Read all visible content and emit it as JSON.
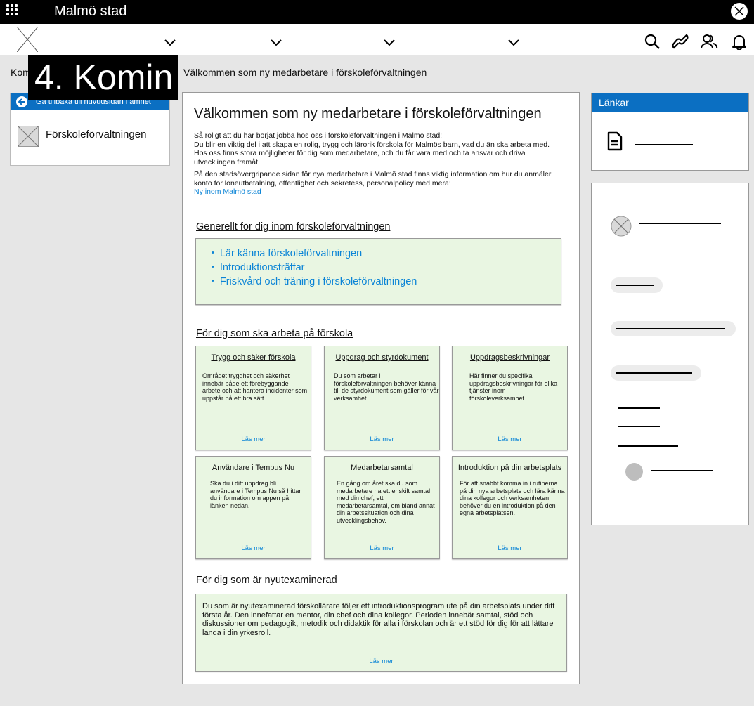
{
  "topbar": {
    "brand": "Malmö stad",
    "apps_icon": "apps-grid-icon",
    "close_icon": "close-circle-icon"
  },
  "nav": {
    "dropdown_icon": "chevron-down-icon",
    "dropdowns": 4,
    "icons": [
      "search-icon",
      "link-icon",
      "users-icon",
      "bell-icon"
    ]
  },
  "breadcrumb": {
    "start": "Kom",
    "current": "Välkommen som ny medarbetare i förskoleförvaltningen"
  },
  "overlay": {
    "step": "4. Komin"
  },
  "left_panel": {
    "back_label": "Gå tillbaka till huvudsidan i ämnet",
    "item_label": "Förskoleförvaltningen"
  },
  "main": {
    "title": "Välkommen som ny medarbetare i förskoleförvaltningen",
    "intro_p1_line1": "Så roligt att du har börjat jobba hos oss i förskoleförvaltningen i Malmö stad!",
    "intro_p1_rest": "Du blir en viktig del i att skapa en rolig, trygg och lärorik förskola för Malmös barn, vad du än ska arbeta med. Hos oss finns stora möjligheter för dig som medarbetare, och du får vara med och ta ansvar och driva utvecklingen framåt.",
    "intro_p2": "På den stadsövergripande sidan för nya medarbetare i Malmö stad finns viktig information om hur du anmäler konto för löneutbetalning, offentlighet och sekretess, personalpolicy med mera:",
    "intro_link": "Ny inom Malmö stad",
    "general_title": "Generellt för dig inom förskoleförvaltningen",
    "general_links": [
      "Lär känna förskoleförvaltningen",
      "Introduktionsträffar",
      "Friskvård och träning i förskoleförvaltningen"
    ],
    "preschool_title": "För dig som ska arbeta på förskola",
    "read_more": "Läs mer",
    "cards": [
      {
        "title": "Trygg och säker förskola",
        "body": "Området trygghet och säkerhet innebär både ett förebyggande arbete och att hantera incidenter som uppstår på ett bra sätt."
      },
      {
        "title": "Uppdrag och styrdokument",
        "body": "Du som arbetar i förskoleförvaltningen behöver känna till de styrdokument som gäller för vår verksamhet."
      },
      {
        "title": "Uppdragsbeskrivningar",
        "body": "Här finner du specifika uppdragsbeskrivningar för olika tjänster inom förskoleverksamhet."
      },
      {
        "title": "Användare i Tempus Nu",
        "body": "Ska du i ditt uppdrag bli användare i Tempus Nu så hittar du information om appen på länken nedan."
      },
      {
        "title": "Medarbetarsamtal",
        "body": "En gång om året ska du som medarbetare ha ett enskilt samtal med din chef, ett medarbetarsamtal, om bland annat din arbetssituation och dina utvecklingsbehov."
      },
      {
        "title": "Introduktion på din arbetsplats",
        "body": "För att snabbt komma in i rutinerna på din nya arbetsplats och lära känna dina kollegor och verksamheten behöver du en introduktion på den egna arbetsplatsen."
      }
    ],
    "graduate_title": "För dig som är nyutexaminerad",
    "graduate_body": "Du som är nyutexaminerad förskollärare följer ett introduktionsprogram ute på din arbetsplats under ditt första år. Den innefattar en mentor, din chef och dina kollegor. Perioden innebär samtal, stöd och diskussioner om pedagogik, metodik och didaktik för alla i förskolan och är ett stöd för dig för att lättare landa i din yrkesroll."
  },
  "right": {
    "links_title": "Länkar",
    "doc_icon": "document-icon"
  },
  "colors": {
    "accent_blue": "#0b6fc2",
    "link_blue": "#0b84d6",
    "card_green": "#e9f6e2"
  }
}
